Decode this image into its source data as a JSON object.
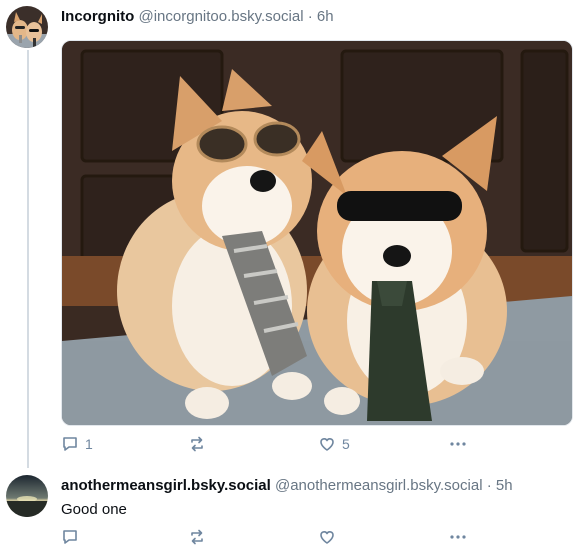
{
  "posts": [
    {
      "display_name": "Incorgnito",
      "handle": "@incorgnitoo.bsky.social",
      "separator": "·",
      "time": "6h",
      "avatar_icon": "corgi-avatar",
      "image_alt": "Two corgis wearing sunglasses and neckties",
      "replies": "1",
      "reposts": "",
      "likes": "5"
    },
    {
      "display_name": "anothermeansgirl.bsky.social",
      "handle": "@anothermeansgirl.bsky.social",
      "separator": "·",
      "time": "5h",
      "avatar_icon": "sunset-avatar",
      "text": "Good one",
      "replies": "",
      "reposts": "",
      "likes": ""
    }
  ],
  "colors": {
    "text": "#0b0f14",
    "muted": "#687684",
    "action_icon": "#6f869f",
    "thread_line": "#d4dbe2"
  }
}
